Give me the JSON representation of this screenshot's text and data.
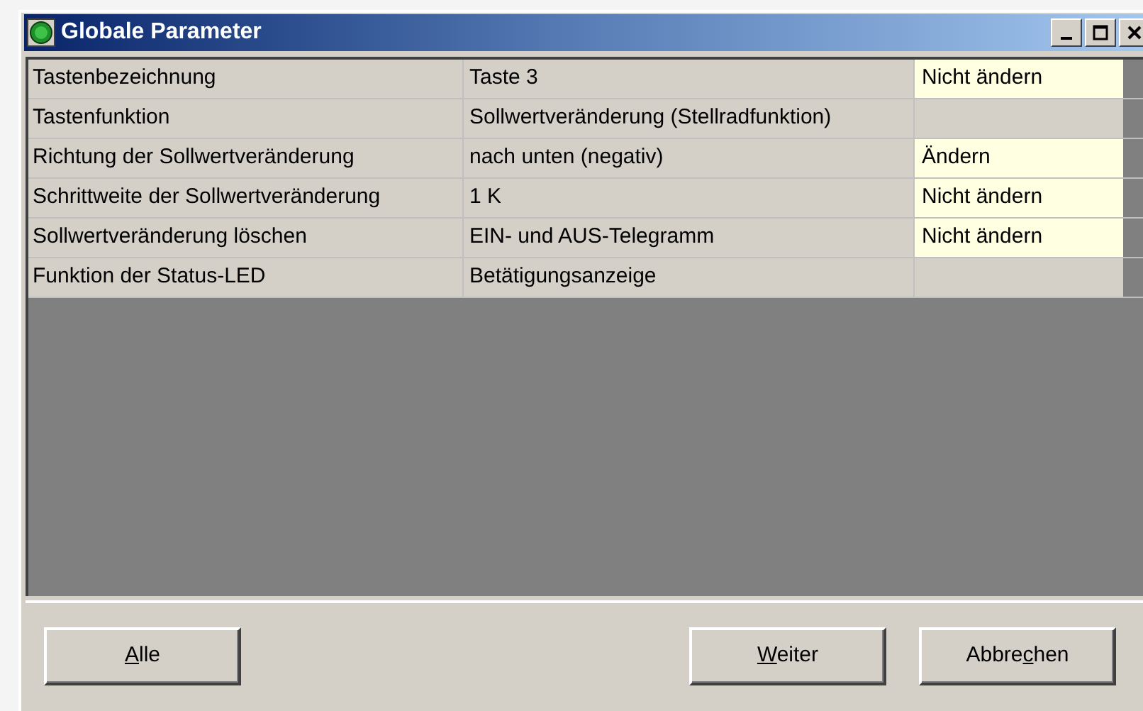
{
  "window": {
    "title": "Globale Parameter"
  },
  "table": {
    "rows": [
      {
        "column_1": "Tastenbezeichnung",
        "column_2": "Taste 3",
        "column_3": "Nicht ändern"
      },
      {
        "column_1": "Tastenfunktion",
        "column_2": "Sollwertveränderung (Stellradfunktion)"
      },
      {
        "column_1": "Richtung der Sollwertveränderung",
        "column_2": "nach unten (negativ)",
        "column_3": "Ändern"
      },
      {
        "column_1": "Schrittweite der Sollwertveränderung",
        "column_2": "1 K",
        "column_3": "Nicht ändern"
      },
      {
        "column_1": "Sollwertveränderung löschen",
        "column_2": "EIN- und AUS-Telegramm",
        "column_3": "Nicht ändern"
      },
      {
        "column_1": "Funktion der Status-LED",
        "column_2": "Betätigungsanzeige"
      }
    ]
  },
  "buttons": [
    {
      "label": [
        {
          "text": "A",
          "underlined": true
        },
        {
          "text": "lle",
          "underlined": false
        }
      ]
    },
    {
      "label": [
        {
          "text": "W",
          "underlined": true
        },
        {
          "text": "eiter",
          "underlined": false
        }
      ]
    },
    {
      "label": [
        {
          "text": "Abbre",
          "underlined": false
        },
        {
          "text": "c",
          "underlined": true
        },
        {
          "text": "hen",
          "underlined": false
        }
      ]
    }
  ]
}
